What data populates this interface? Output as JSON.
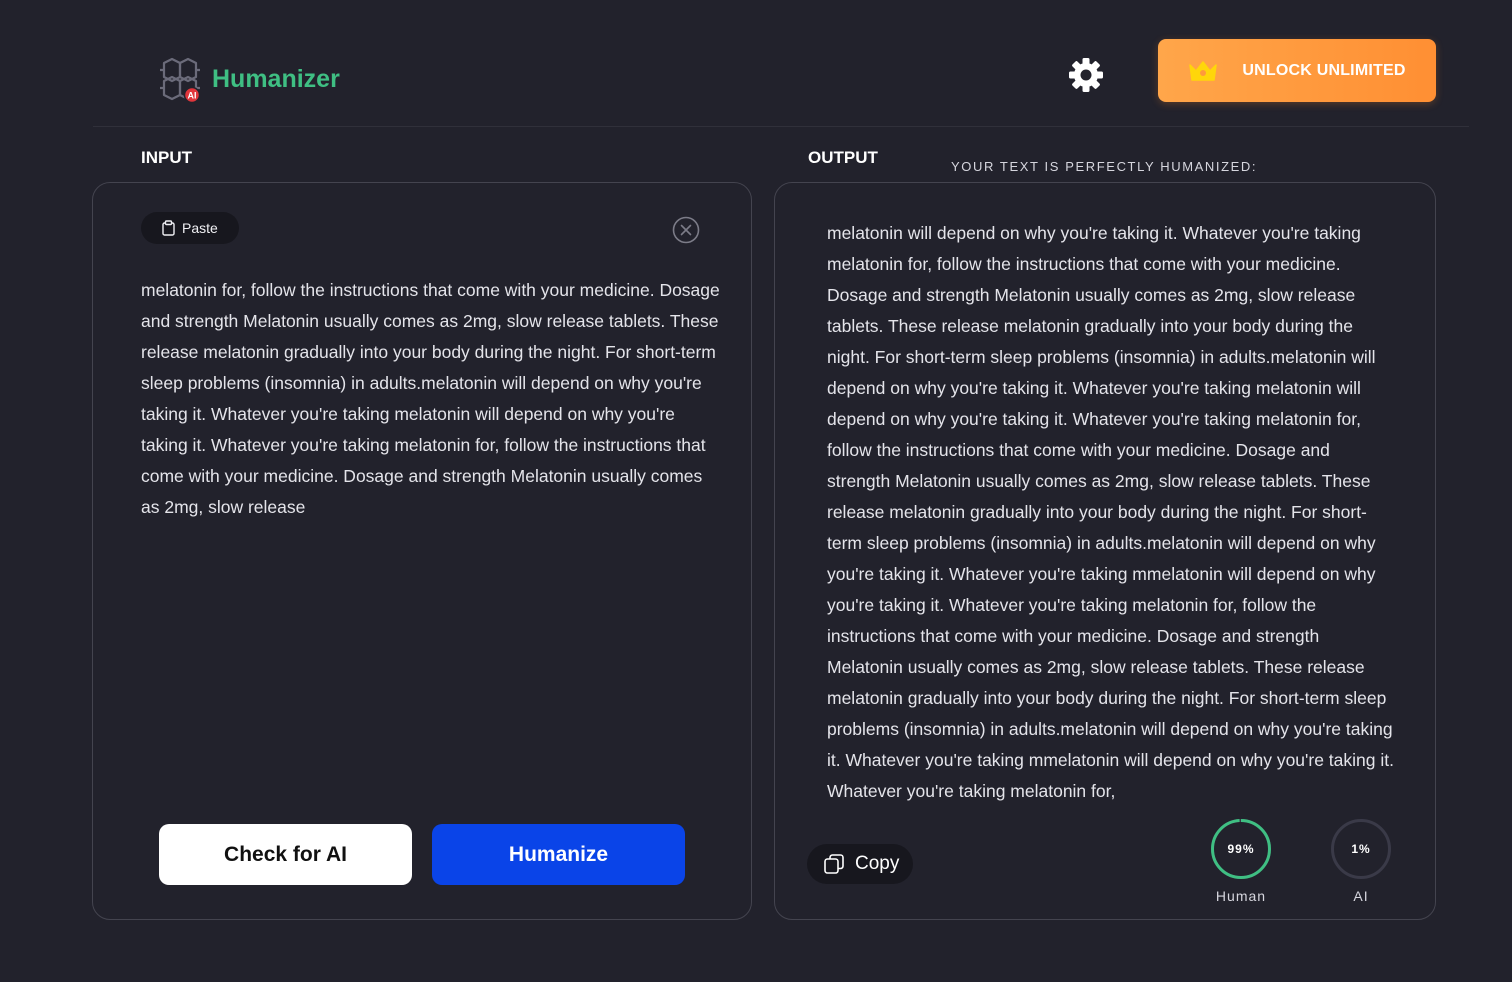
{
  "header": {
    "brand": "Humanizer",
    "unlock_label": "UNLOCK UNLIMITED",
    "brand_color": "#3fbf83",
    "unlock_color": "#ff9a3c"
  },
  "input": {
    "section_label": "INPUT",
    "paste_label": "Paste",
    "text": "melatonin for, follow the instructions that come with your medicine. Dosage and strength Melatonin usually comes as 2mg, slow release tablets. These release melatonin gradually into your body during the night. For short-term sleep problems (insomnia) in adults.melatonin will depend on why you're taking it. Whatever you're taking melatonin will depend on why you're taking it. Whatever you're taking melatonin for, follow the instructions that come with your medicine. Dosage and strength Melatonin usually comes as 2mg, slow release",
    "check_label": "Check for AI",
    "humanize_label": "Humanize",
    "humanize_color": "#0a44e8"
  },
  "output": {
    "section_label": "OUTPUT",
    "status": "YOUR TEXT IS PERFECTLY HUMANIZED:",
    "text": "melatonin will depend on why you're taking it. Whatever you're taking melatonin for, follow the instructions that come with your medicine. Dosage and strength Melatonin usually comes as 2mg, slow release tablets. These release melatonin gradually into your body during the night. For short-term sleep problems (insomnia) in adults.melatonin will depend on why you're taking it. Whatever you're taking melatonin will depend on why you're taking it. Whatever you're taking melatonin for, follow the instructions that come with your medicine. Dosage and strength Melatonin usually comes as 2mg, slow release tablets. These release melatonin gradually into your body during the night. For short-term sleep problems (insomnia) in adults.melatonin will depend on why you're taking it. Whatever you're taking mmelatonin will depend on why you're taking it. Whatever you're taking melatonin for, follow the instructions that come with your medicine. Dosage and strength Melatonin usually comes as 2mg, slow release tablets. These release melatonin gradually into your body during the night. For short-term sleep problems (insomnia) in adults.melatonin will depend on why you're taking it. Whatever you're taking mmelatonin will depend on why you're taking it. Whatever you're taking melatonin for,",
    "copy_label": "Copy",
    "scores": {
      "human_value": "99%",
      "human_label": "Human",
      "human_fraction": 0.99,
      "human_color": "#3fbf83",
      "ai_value": "1%",
      "ai_label": "AI",
      "ai_fraction": 0.01,
      "ai_color": "#3a3a48"
    }
  }
}
